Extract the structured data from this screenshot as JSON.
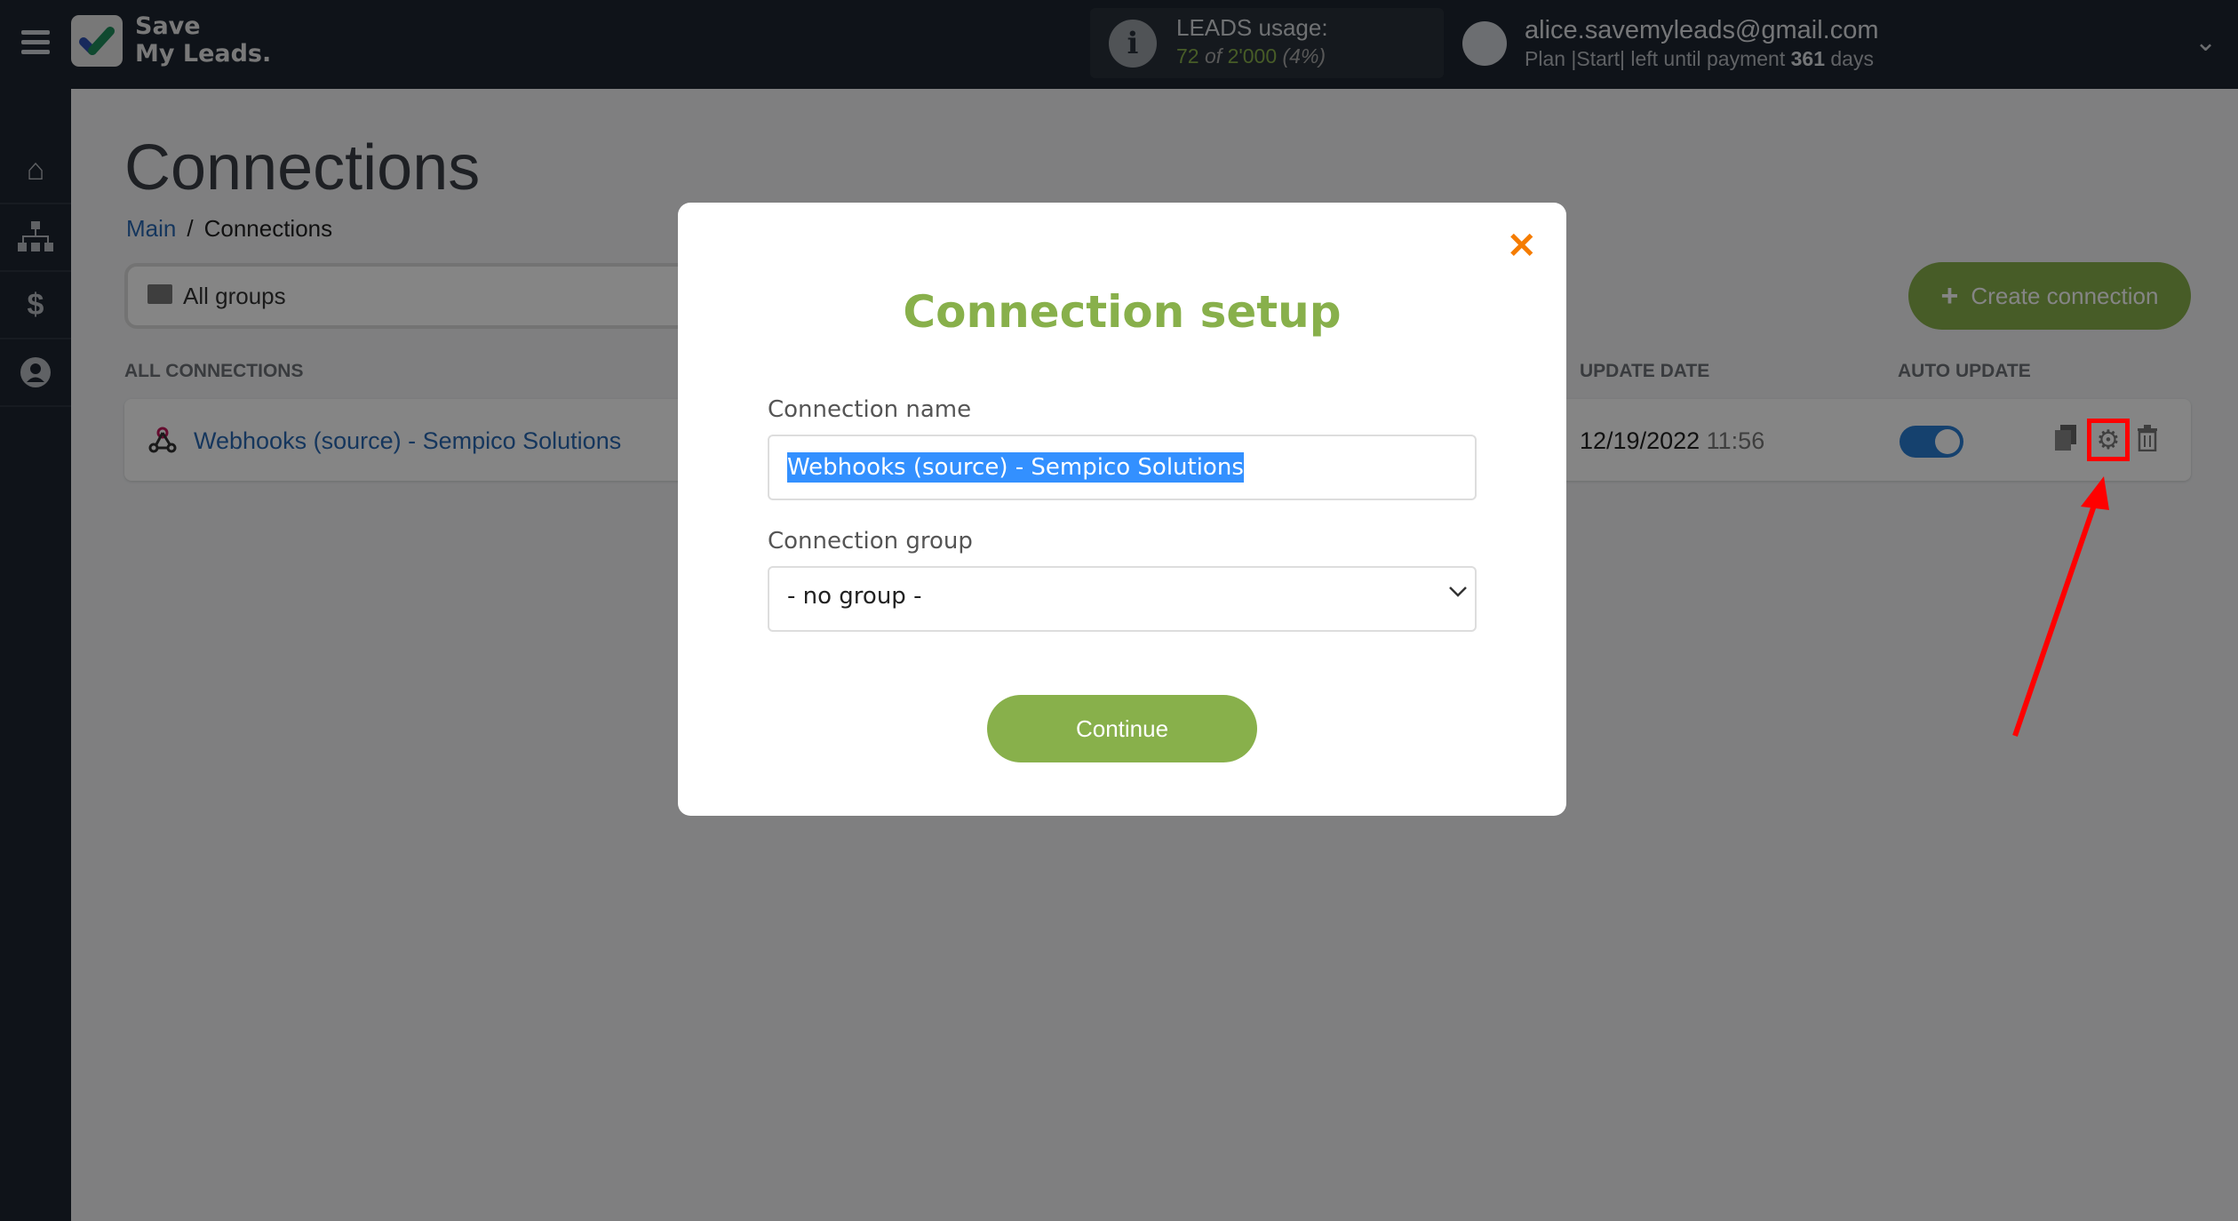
{
  "header": {
    "logo_line1": "Save",
    "logo_line2": "My Leads.",
    "leads_usage_label": "LEADS usage:",
    "leads_used": "72",
    "leads_of": "of",
    "leads_total": "2'000",
    "leads_percent": "(4%)",
    "user_email": "alice.savemyleads@gmail.com",
    "plan_prefix": "Plan |Start| left until payment",
    "plan_days": "361",
    "plan_suffix": "days"
  },
  "sidebar": {
    "items": [
      {
        "icon": "home-icon"
      },
      {
        "icon": "sitemap-icon"
      },
      {
        "icon": "dollar-icon"
      },
      {
        "icon": "user-icon"
      }
    ]
  },
  "main": {
    "title": "Connections",
    "breadcrumb": {
      "main": "Main",
      "separator": "/",
      "current": "Connections"
    },
    "groups_filter": "All groups",
    "create_button": "Create connection",
    "columns": {
      "all_connections": "ALL CONNECTIONS",
      "update_date": "UPDATE DATE",
      "auto_update": "AUTO UPDATE"
    },
    "rows": [
      {
        "name": "Webhooks (source) - Sempico Solutions",
        "date": "12/19/2022",
        "time": "11:56",
        "auto_update": true
      }
    ]
  },
  "modal": {
    "title": "Connection setup",
    "name_label": "Connection name",
    "name_value": "Webhooks (source) - Sempico Solutions",
    "group_label": "Connection group",
    "group_value": "- no group -",
    "continue_label": "Continue",
    "close_symbol": "✕"
  },
  "colors": {
    "accent_green": "#88b04b",
    "close_orange": "#f57c00",
    "link_blue": "#2a69b3",
    "annotation_red": "#ff0000"
  }
}
